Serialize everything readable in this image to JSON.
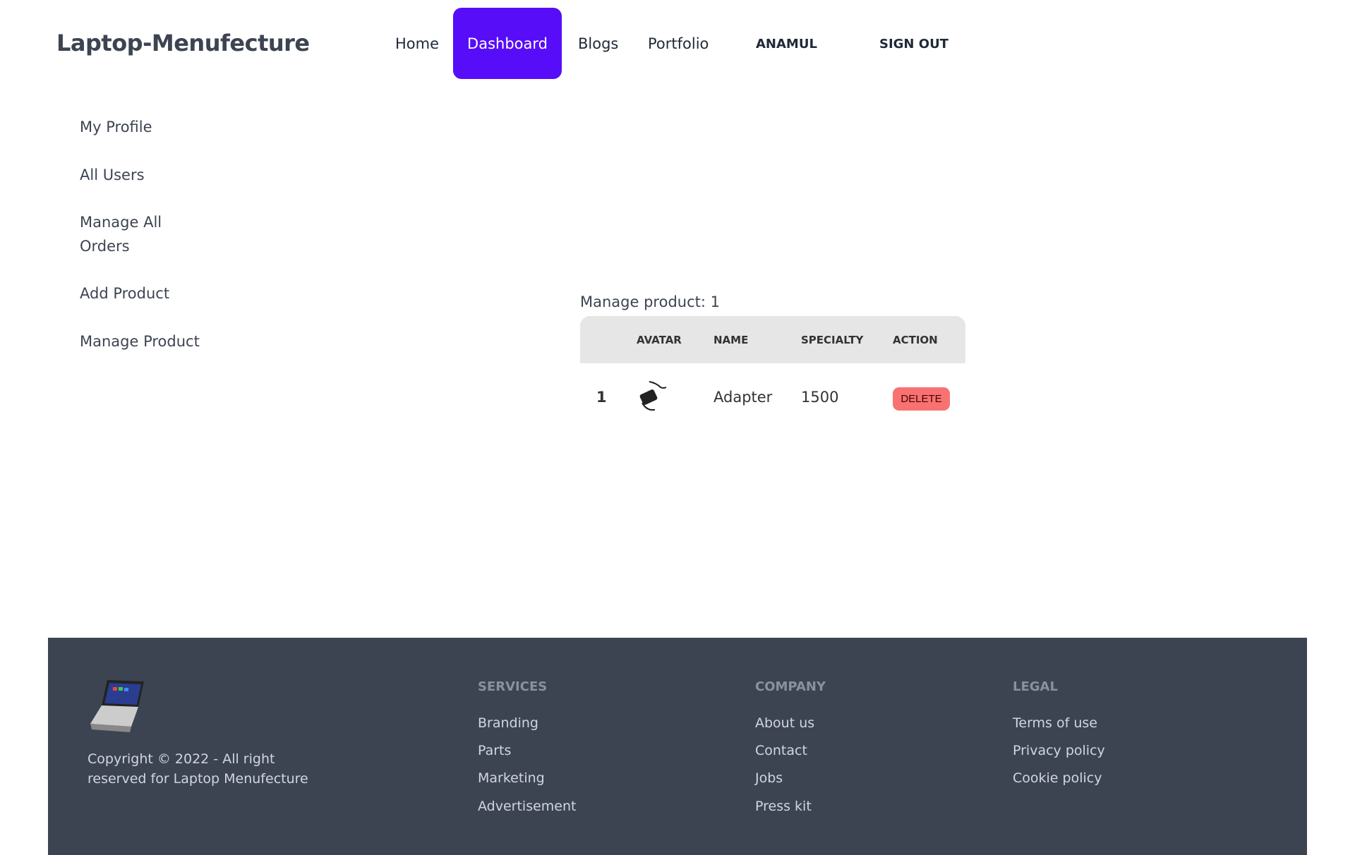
{
  "header": {
    "logo": "Laptop-Menufecture",
    "nav": [
      "Home",
      "Dashboard",
      "Blogs",
      "Portfolio"
    ],
    "user": "ANAMUL",
    "sign_out": "SIGN OUT",
    "active_color": "#570df8"
  },
  "sidebar": {
    "items": [
      "My Profile",
      "All Users",
      "Manage All Orders",
      "Add Product",
      "Manage Product"
    ]
  },
  "main": {
    "title": "Manage product: 1",
    "columns": [
      "",
      "AVATAR",
      "NAME",
      "SPECIALTY",
      "ACTION"
    ],
    "rows": [
      {
        "index": "1",
        "avatar": "adapter-image",
        "name": "Adapter",
        "specialty": "1500",
        "action": "DELETE"
      }
    ]
  },
  "footer": {
    "copyright": "Copyright © 2022 - All right reserved for Laptop Menufecture",
    "columns": [
      {
        "title": "SERVICES",
        "links": [
          "Branding",
          "Parts",
          "Marketing",
          "Advertisement"
        ]
      },
      {
        "title": "COMPANY",
        "links": [
          "About us",
          "Contact",
          "Jobs",
          "Press kit"
        ]
      },
      {
        "title": "LEGAL",
        "links": [
          "Terms of use",
          "Privacy policy",
          "Cookie policy"
        ]
      }
    ]
  }
}
